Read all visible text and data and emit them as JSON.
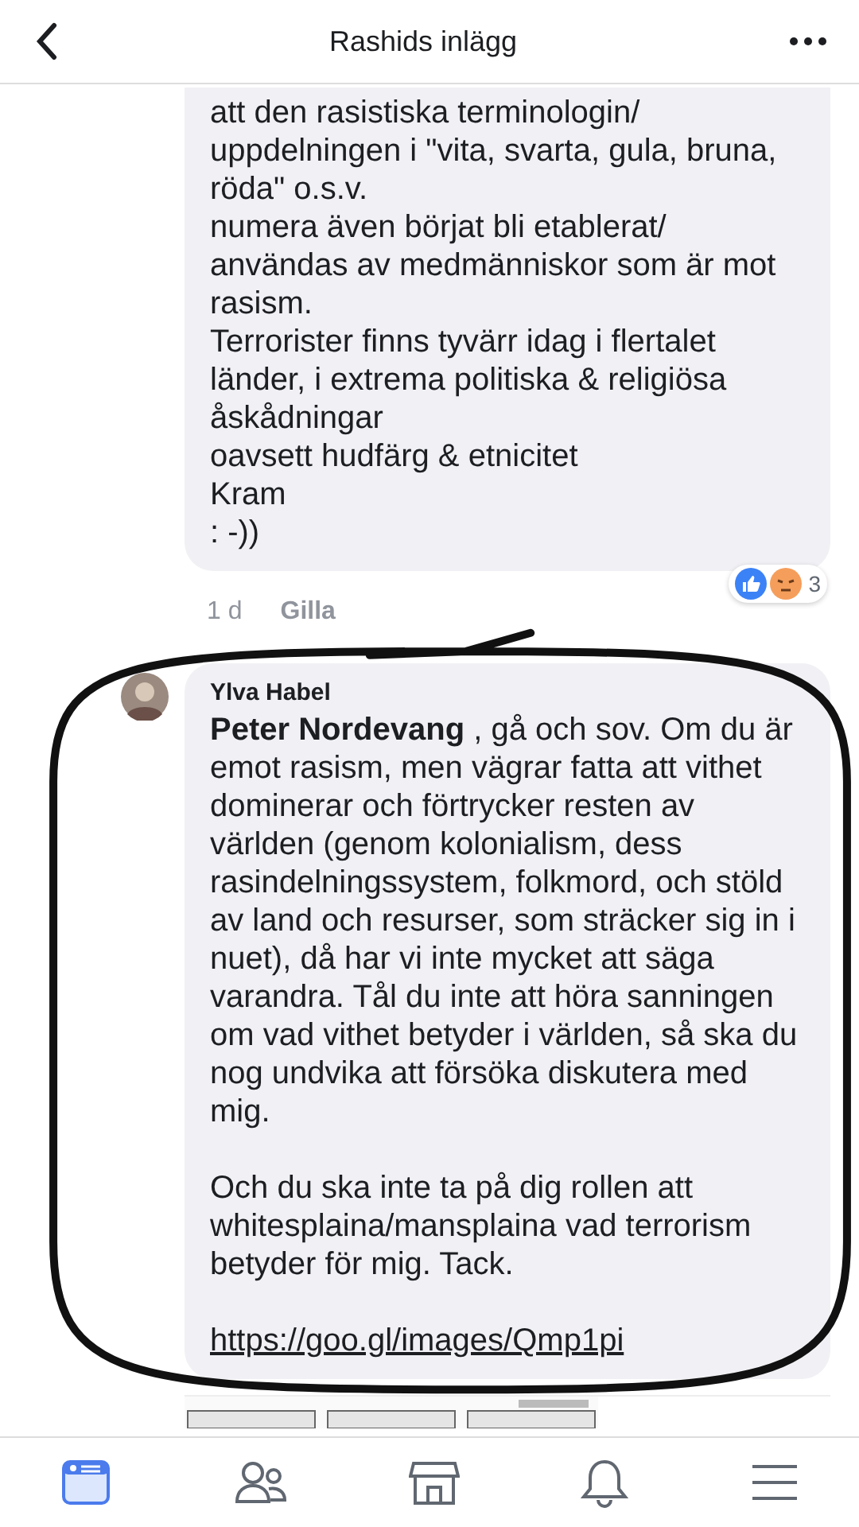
{
  "header": {
    "title": "Rashids inlägg"
  },
  "comments": [
    {
      "paragraphs": [
        "att den rasistiska terminologin/ uppdelningen i \"vita, svarta, gula, bruna, röda\" o.s.v.",
        "numera även börjat bli etablerat/ användas av medmänniskor som är mot rasism.",
        "Terrorister finns tyvärr idag i flertalet länder, i extrema politiska & religiösa åskådningar",
        "oavsett hudfärg & etnicitet",
        "Kram",
        ": -))"
      ],
      "time": "1 d",
      "like_label": "Gilla",
      "reaction_count": "3"
    },
    {
      "author": "Ylva Habel",
      "paragraphs": [
        "**Peter Nordevang** , gå och sov. Om du är emot rasism, men vägrar fatta att vithet dominerar och förtrycker resten av världen (genom kolonialism, dess rasindelningssystem, folkmord, och stöld av land och resurser, som sträcker sig in i nuet), då har vi inte mycket att säga varandra. Tål du inte att höra sanningen om vad vithet betyder i världen, så ska du nog undvika att försöka diskutera med mig.",
        "Och du ska inte ta på dig rollen att whitesplaina/mansplaina vad terrorism betyder för mig. Tack."
      ],
      "link": "https://goo.gl/images/Qmp1pi"
    }
  ],
  "tabs": [
    {
      "kind": "feed",
      "selected": true
    },
    {
      "kind": "friends",
      "selected": false
    },
    {
      "kind": "marketplace",
      "selected": false
    },
    {
      "kind": "notifications",
      "selected": false
    },
    {
      "kind": "menu",
      "selected": false
    }
  ]
}
